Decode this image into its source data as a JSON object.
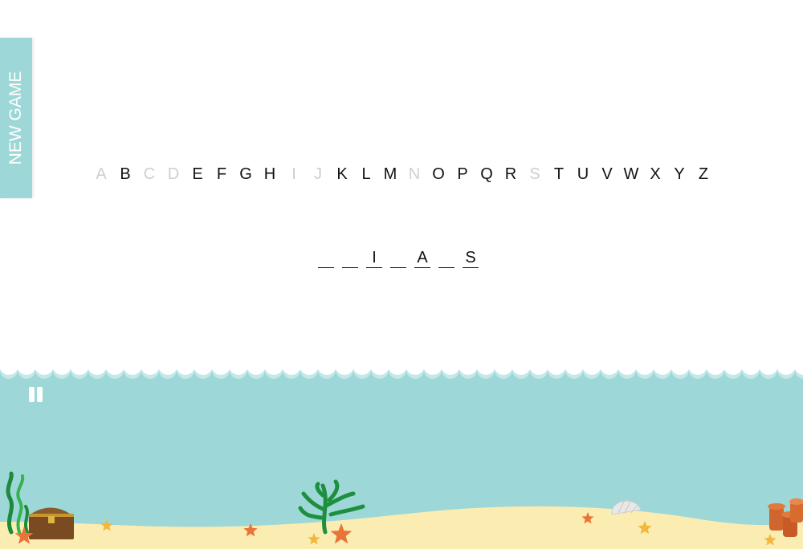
{
  "new_game_label": "NEW GAME",
  "alphabet": [
    {
      "letter": "A",
      "used": true
    },
    {
      "letter": "B",
      "used": false
    },
    {
      "letter": "C",
      "used": true
    },
    {
      "letter": "D",
      "used": true
    },
    {
      "letter": "E",
      "used": false
    },
    {
      "letter": "F",
      "used": false
    },
    {
      "letter": "G",
      "used": false
    },
    {
      "letter": "H",
      "used": false
    },
    {
      "letter": "I",
      "used": true
    },
    {
      "letter": "J",
      "used": true
    },
    {
      "letter": "K",
      "used": false
    },
    {
      "letter": "L",
      "used": false
    },
    {
      "letter": "M",
      "used": false
    },
    {
      "letter": "N",
      "used": true
    },
    {
      "letter": "O",
      "used": false
    },
    {
      "letter": "P",
      "used": false
    },
    {
      "letter": "Q",
      "used": false
    },
    {
      "letter": "R",
      "used": false
    },
    {
      "letter": "S",
      "used": true
    },
    {
      "letter": "T",
      "used": false
    },
    {
      "letter": "U",
      "used": false
    },
    {
      "letter": "V",
      "used": false
    },
    {
      "letter": "W",
      "used": false
    },
    {
      "letter": "X",
      "used": false
    },
    {
      "letter": "Y",
      "used": false
    },
    {
      "letter": "Z",
      "used": false
    }
  ],
  "word_slots": [
    "",
    "",
    "I",
    "",
    "A",
    "",
    "S"
  ],
  "icons": {
    "pause": "pause-icon"
  },
  "colors": {
    "sea": "#9dd7d8",
    "sand": "#fbecb2",
    "used_letter": "#cfcfcf",
    "letter": "#111111"
  }
}
